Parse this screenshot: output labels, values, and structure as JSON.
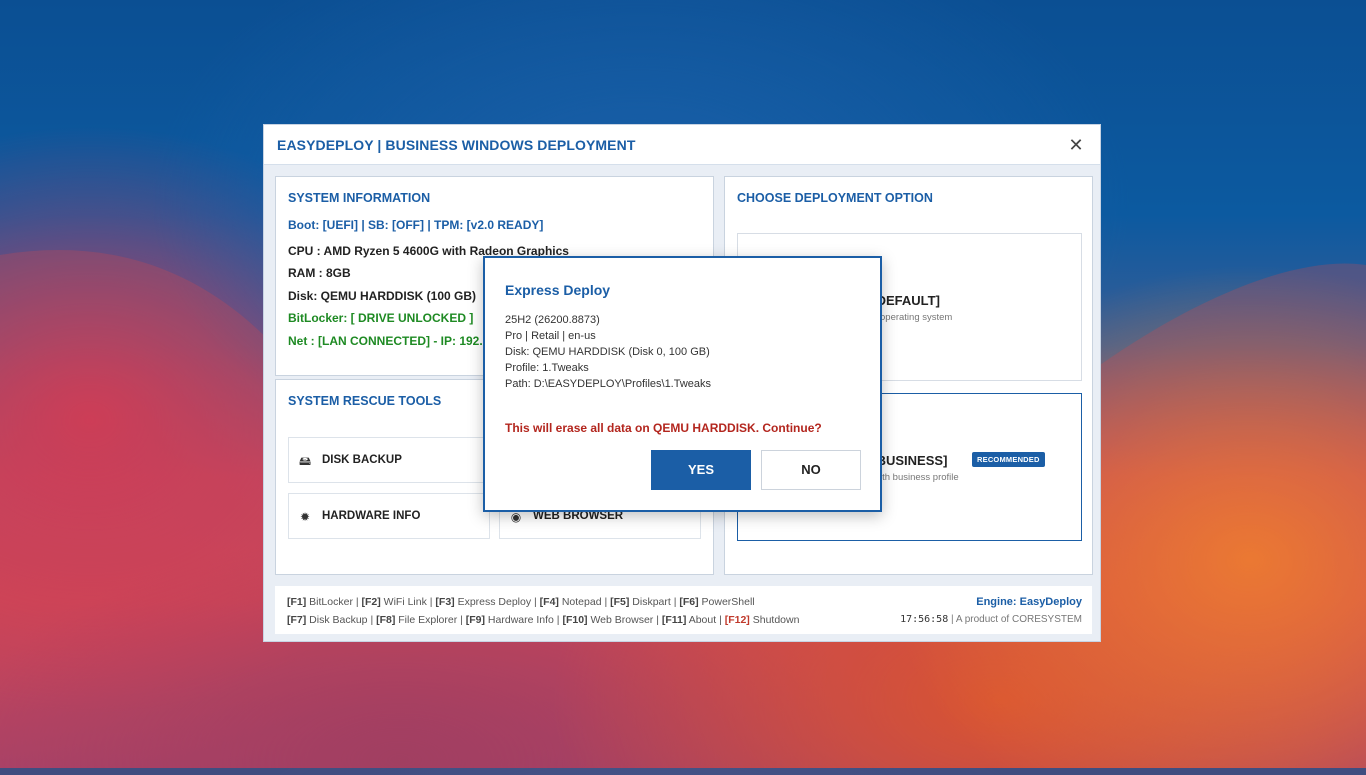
{
  "window": {
    "title": "EASYDEPLOY | BUSINESS WINDOWS DEPLOYMENT",
    "close_glyph": "✕"
  },
  "system_info": {
    "heading": "SYSTEM INFORMATION",
    "boot_line": "Boot: [UEFI]  |  SB: [OFF]  |  TPM: [v2.0 READY]",
    "cpu": "CPU : AMD Ryzen 5 4600G with Radeon Graphics",
    "ram": "RAM : 8GB",
    "disk": "Disk: QEMU HARDDISK (100 GB)",
    "bitlocker": "BitLocker: [ DRIVE UNLOCKED ]",
    "net": "Net : [LAN CONNECTED] - IP: 192.1"
  },
  "rescue_tools": {
    "heading": "SYSTEM RESCUE TOOLS",
    "items": [
      {
        "label": "DISK BACKUP",
        "icon": "disk-backup-icon",
        "glyph": "🖴"
      },
      {
        "label": "HARDWARE INFO",
        "icon": "chip-icon",
        "glyph": "✹"
      },
      {
        "label": "WEB BROWSER",
        "icon": "globe-icon",
        "glyph": "◉"
      }
    ]
  },
  "deployment": {
    "heading": "CHOOSE DEPLOYMENT OPTION",
    "options": [
      {
        "title_visible": "S [DEFAULT]",
        "subtitle_visible": "operating system"
      },
      {
        "title_visible": "S [BUSINESS]",
        "subtitle_visible": "ith business profile",
        "badge": "RECOMMENDED"
      }
    ]
  },
  "footer": {
    "line1": [
      {
        "key": "[F1]",
        "label": " BitLocker | "
      },
      {
        "key": "[F2]",
        "label": " WiFi Link | "
      },
      {
        "key": "[F3]",
        "label": " Express Deploy | "
      },
      {
        "key": "[F4]",
        "label": " Notepad | "
      },
      {
        "key": "[F5]",
        "label": " Diskpart | "
      },
      {
        "key": "[F6]",
        "label": " PowerShell"
      }
    ],
    "line2": [
      {
        "key": "[F7]",
        "label": " Disk Backup | "
      },
      {
        "key": "[F8]",
        "label": " File Explorer | "
      },
      {
        "key": "[F9]",
        "label": " Hardware Info | "
      },
      {
        "key": "[F10]",
        "label": " Web Browser | "
      },
      {
        "key": "[F11]",
        "label": " About | "
      },
      {
        "key": "[F12]",
        "label": " Shutdown",
        "red": true
      }
    ],
    "engine": "Engine: EasyDeploy",
    "clock": "17:56:58",
    "product": " |  A product of CORESYSTEM"
  },
  "dialog": {
    "title": "Express Deploy",
    "lines": [
      "25H2 (26200.8873)",
      "Pro | Retail | en-us",
      "Disk: QEMU HARDDISK (Disk 0, 100 GB)",
      "Profile: 1.Tweaks",
      "Path: D:\\EASYDEPLOY\\Profiles\\1.Tweaks"
    ],
    "warning": "This will erase all data on QEMU HARDDISK. Continue?",
    "yes_label": "YES",
    "no_label": "NO"
  },
  "colors": {
    "accent": "#1b5ea6",
    "success": "#1e8a23",
    "danger": "#b3261e"
  }
}
